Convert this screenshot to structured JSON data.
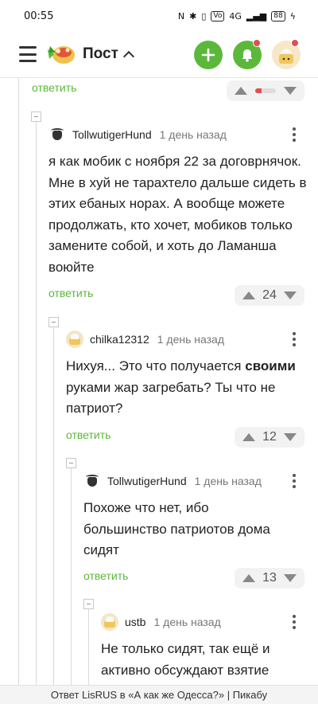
{
  "status_bar": {
    "time": "00:55",
    "network": "4G",
    "battery": "88"
  },
  "header": {
    "title": "Пост"
  },
  "thread": {
    "top_reply_label": "ответить",
    "comments": [
      {
        "author": "TollwutigerHund",
        "date": "1 день назад",
        "text": "я как мобик с ноября 22 за договрнячок. Мне в хуй не тарахтело дальше сидеть в этих ебаных норах. А вообще можете продолжать, кто хочет, мобиков только замените собой, и хоть до Ламанша воюйте",
        "reply_label": "ответить",
        "votes": "24"
      },
      {
        "author": "chilka12312",
        "date": "1 день назад",
        "text_before": "Нихуя... Это что получается ",
        "text_bold": "своими",
        "text_after": " руками жар загребать? Ты что не патриот?",
        "reply_label": "ответить",
        "votes": "12"
      },
      {
        "author": "TollwutigerHund",
        "date": "1 день назад",
        "text": "Похоже что нет, ибо большинство патриотов дома сидят",
        "reply_label": "ответить",
        "votes": "13"
      },
      {
        "author": "ustb",
        "date": "1 день назад",
        "text": "Не только сидят, так ещё и активно обсуждают взятие"
      }
    ]
  },
  "footer": {
    "text": "Ответ LisRUS в «А как же Одесса?» | Пикабу"
  },
  "colors": {
    "accent": "#5bb83a",
    "alert": "#e04f4f"
  }
}
